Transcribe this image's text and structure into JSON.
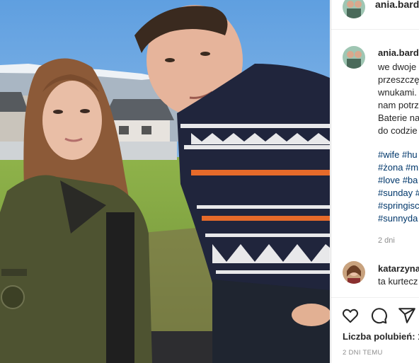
{
  "post": {
    "username": "ania.bardo",
    "caption_lines": [
      "we dwoje",
      "przeszczę",
      "wnukami.",
      "nam potrz",
      "Baterie na",
      "do codzie"
    ],
    "hashtags": [
      "#wife #hu",
      "#żona #m",
      "#love #ba",
      "#sunday #",
      "#springisc",
      "#sunnyda"
    ],
    "time_ago": "2 dni",
    "comment": {
      "username": "katarzyna",
      "text": "ta kurtecz"
    },
    "likes_label": "Liczba polubień: 1",
    "date_label": "2 DNI TEMU"
  },
  "icons": {
    "like": "heart-icon",
    "comment": "comment-icon",
    "share": "share-icon"
  },
  "colors": {
    "hashtag": "#00376b",
    "text": "#262626",
    "muted": "#8e8e8e",
    "border": "#dbdbdb"
  }
}
